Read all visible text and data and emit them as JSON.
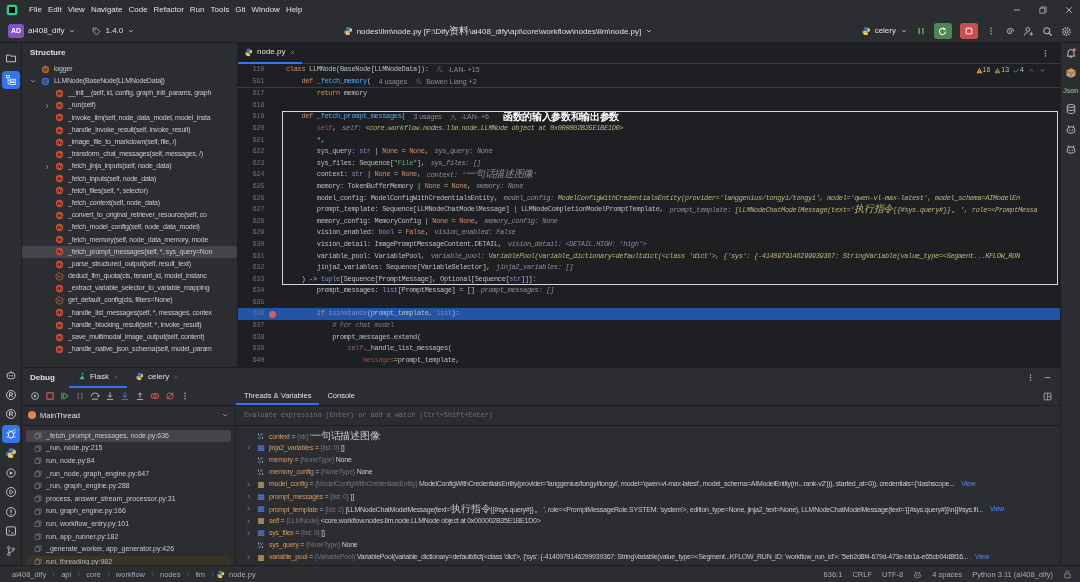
{
  "menu": [
    "File",
    "Edit",
    "View",
    "Navigate",
    "Code",
    "Refactor",
    "Run",
    "Tools",
    "Git",
    "Window",
    "Help"
  ],
  "toolbar": {
    "project_initials": "AD",
    "project": "ai408_dify",
    "version": "1.4.0",
    "file_path": "nodes\\llm\\node.py [F:\\Dify资料\\ai408_dify\\api\\core\\workflow\\nodes\\llm\\node.py]",
    "run_config": "celery"
  },
  "left_tools": [
    {
      "kind": "folder",
      "selected": false
    },
    {
      "kind": "structure",
      "selected": true
    }
  ],
  "lower_tools": [
    {
      "kind": "robot",
      "selected": false
    },
    {
      "kind": "remote",
      "selected": false
    },
    {
      "kind": "remote",
      "selected": false
    },
    {
      "kind": "debug",
      "selected": true
    },
    {
      "kind": "python",
      "selected": false
    },
    {
      "kind": "services",
      "selected": false
    },
    {
      "kind": "run",
      "selected": false
    },
    {
      "kind": "problems",
      "selected": false
    },
    {
      "kind": "terminal",
      "selected": false
    },
    {
      "kind": "git",
      "selected": false
    }
  ],
  "right_tools": [
    {
      "kind": "bell"
    },
    {
      "kind": "plugin"
    },
    {
      "kind": "label",
      "label": "Json"
    },
    {
      "kind": "database"
    },
    {
      "kind": "assistant"
    },
    {
      "kind": "assistant"
    }
  ],
  "structure": {
    "title": "Structure",
    "items": [
      {
        "label": "logger",
        "kind": "variable",
        "selected": false
      },
      {
        "label": "LLMNode(BaseNode[LLMNodeData])",
        "kind": "class",
        "expanded": true,
        "selected": false,
        "children": [
          {
            "label": "__init__(self, id, config, graph_init_params, graph",
            "kind": "method",
            "selected": false
          },
          {
            "label": "_run(self)",
            "kind": "method",
            "expanded": false,
            "selected": false
          },
          {
            "label": "_invoke_llm(self, node_data_model, model_insta",
            "kind": "method",
            "selected": false
          },
          {
            "label": "_handle_invoke_result(self, invoke_result)",
            "kind": "method",
            "selected": false
          },
          {
            "label": "_image_file_to_markdown(self, file, /)",
            "kind": "method",
            "selected": false
          },
          {
            "label": "_transform_chat_messages(self, messages, /)",
            "kind": "method",
            "selected": false
          },
          {
            "label": "_fetch_jinja_inputs(self, node_data)",
            "kind": "method",
            "expanded": false,
            "selected": false
          },
          {
            "label": "_fetch_inputs(self, node_data)",
            "kind": "method",
            "selected": false
          },
          {
            "label": "_fetch_files(self, *, selector)",
            "kind": "method",
            "selected": false
          },
          {
            "label": "_fetch_context(self, node_data)",
            "kind": "method",
            "selected": false
          },
          {
            "label": "_convert_to_original_retriever_resource(self, co",
            "kind": "method",
            "selected": false
          },
          {
            "label": "_fetch_model_config(self, node_data_model)",
            "kind": "method",
            "selected": false
          },
          {
            "label": "_fetch_memory(self, node_data_memory, mode",
            "kind": "method",
            "selected": false
          },
          {
            "label": "_fetch_prompt_messages(self, *, sys_query=Non",
            "kind": "method",
            "selected": true
          },
          {
            "label": "_parse_structured_output(self, result_text)",
            "kind": "method",
            "selected": false
          },
          {
            "label": "deduct_llm_quota(cls, tenant_id, model_instanc",
            "kind": "static",
            "selected": false
          },
          {
            "label": "_extract_variable_selector_to_variable_mapping",
            "kind": "method",
            "selected": false
          },
          {
            "label": "get_default_config(cls, filters=None)",
            "kind": "static",
            "selected": false
          },
          {
            "label": "_handle_list_messages(self, *, messages, contex",
            "kind": "method",
            "selected": false
          },
          {
            "label": "_handle_blocking_result(self, *, invoke_result)",
            "kind": "method",
            "selected": false
          },
          {
            "label": "_save_multimodal_image_output(self, content)",
            "kind": "method",
            "selected": false
          },
          {
            "label": "_handle_native_json_schema(self, model_param",
            "kind": "method",
            "selected": false
          }
        ]
      }
    ]
  },
  "editor": {
    "tab": {
      "label": "node.py",
      "selected": true
    },
    "inspections": [
      {
        "kind": "warning",
        "count": "16"
      },
      {
        "kind": "weak",
        "count": "13"
      },
      {
        "kind": "ok",
        "count": "4"
      }
    ],
    "sticky": [
      {
        "number": "110",
        "parts": [
          {
            "kind": "kw",
            "text": "class "
          },
          {
            "kind": "plain",
            "text": "LLMNode(BaseNode[LLMNodeData]):"
          }
        ],
        "author": "-LAN- +15"
      },
      {
        "number": "591",
        "parts": [
          {
            "kind": "kw",
            "text": "    def "
          },
          {
            "kind": "fn",
            "text": "_fetch_memory"
          },
          {
            "kind": "plain",
            "text": "("
          }
        ],
        "usages": "4 usages",
        "author": "Bowen Liang +2"
      }
    ],
    "lines_before": [
      {
        "number": "617",
        "parts": [
          {
            "kind": "kw",
            "text": "        return "
          },
          {
            "kind": "plain",
            "text": "memory"
          }
        ],
        "breakpoint": false,
        "current": false
      },
      {
        "number": "618",
        "breakpoint": false,
        "current": false
      }
    ],
    "highlight": {
      "note": "函数的输入参数和输出参数",
      "lines": [
        {
          "number": "619",
          "parts": [
            {
              "kind": "kw",
              "text": "    def "
            },
            {
              "kind": "fn",
              "text": "_fetch_prompt_messages"
            },
            {
              "kind": "plain",
              "text": "("
            }
          ],
          "usages": "3 usages",
          "author": "-LAN- +6",
          "breakpoint": false,
          "current": false
        },
        {
          "number": "620",
          "parts": [
            {
              "kind": "self",
              "text": "        self"
            },
            {
              "kind": "plain",
              "text": ","
            }
          ],
          "hint": "self: ",
          "hint_value": "<core.workflow.nodes.llm.node.LLMNode object at 0x000002B35E1BE1D0>",
          "breakpoint": false,
          "current": false
        },
        {
          "number": "621",
          "parts": [
            {
              "kind": "plain",
              "text": "        *,"
            }
          ],
          "breakpoint": false,
          "current": false
        },
        {
          "number": "622",
          "parts": [
            {
              "kind": "plain",
              "text": "        sys_query: "
            },
            {
              "kind": "builtin",
              "text": "str"
            },
            {
              "kind": "plain",
              "text": " | "
            },
            {
              "kind": "kw",
              "text": "None"
            },
            {
              "kind": "plain",
              "text": " = "
            },
            {
              "kind": "kw",
              "text": "None"
            },
            {
              "kind": "plain",
              "text": ","
            }
          ],
          "hint": "sys_query: None",
          "breakpoint": false,
          "current": false
        },
        {
          "number": "623",
          "parts": [
            {
              "kind": "plain",
              "text": "        sys_files: Sequence["
            },
            {
              "kind": "str",
              "text": "\"File\""
            },
            {
              "kind": "plain",
              "text": "],"
            }
          ],
          "hint": "sys_files: []",
          "breakpoint": false,
          "current": false
        },
        {
          "number": "624",
          "parts": [
            {
              "kind": "plain",
              "text": "        context: "
            },
            {
              "kind": "builtin",
              "text": "str"
            },
            {
              "kind": "plain",
              "text": " | "
            },
            {
              "kind": "kw",
              "text": "None"
            },
            {
              "kind": "plain",
              "text": " = "
            },
            {
              "kind": "kw",
              "text": "None"
            },
            {
              "kind": "plain",
              "text": ","
            }
          ],
          "hint": "context: '一句话描述图像'",
          "breakpoint": false,
          "current": false
        },
        {
          "number": "625",
          "parts": [
            {
              "kind": "plain",
              "text": "        memory: TokenBufferMemory | "
            },
            {
              "kind": "kw",
              "text": "None"
            },
            {
              "kind": "plain",
              "text": " = "
            },
            {
              "kind": "kw",
              "text": "None"
            },
            {
              "kind": "plain",
              "text": ","
            }
          ],
          "hint": "memory: None",
          "breakpoint": false,
          "current": false
        },
        {
          "number": "626",
          "parts": [
            {
              "kind": "plain",
              "text": "        model_config: ModelConfigWithCredentialsEntity,"
            }
          ],
          "hint": "model_config: ",
          "hint_value": "ModelConfigWithCredentialsEntity(provider='langgenius/tongyi/tongyi', model='qwen-vl-max-latest', model_schema=AIModelEn",
          "breakpoint": false,
          "current": false
        },
        {
          "number": "627",
          "parts": [
            {
              "kind": "plain",
              "text": "        prompt_template: Sequence[LLMNodeChatModelMessage] | LLMNodeCompletionModelPromptTemplate,"
            }
          ],
          "hint": "prompt_template: ",
          "hint_value": "[LLMNodeChatModelMessage(text='执行指令{{#sys.query#}}。', role=<PromptMessa",
          "breakpoint": false,
          "current": false
        },
        {
          "number": "628",
          "parts": [
            {
              "kind": "plain",
              "text": "        memory_config: MemoryConfig | "
            },
            {
              "kind": "kw",
              "text": "None"
            },
            {
              "kind": "plain",
              "text": " = "
            },
            {
              "kind": "kw",
              "text": "None"
            },
            {
              "kind": "plain",
              "text": ","
            }
          ],
          "hint": "memory_config: None",
          "breakpoint": false,
          "current": false
        },
        {
          "number": "629",
          "parts": [
            {
              "kind": "plain",
              "text": "        vision_enabled: "
            },
            {
              "kind": "builtin",
              "text": "bool"
            },
            {
              "kind": "plain",
              "text": " = "
            },
            {
              "kind": "kw",
              "text": "False"
            },
            {
              "kind": "plain",
              "text": ","
            }
          ],
          "hint": "vision_enabled: False",
          "breakpoint": false,
          "current": false
        },
        {
          "number": "630",
          "parts": [
            {
              "kind": "plain",
              "text": "        vision_detail: ImagePromptMessageContent.DETAIL,"
            }
          ],
          "hint": "vision_detail: <DETAIL.HIGH: 'high'>",
          "breakpoint": false,
          "current": false
        },
        {
          "number": "631",
          "parts": [
            {
              "kind": "plain",
              "text": "        variable_pool: VariablePool,"
            }
          ],
          "hint": "variable_pool: ",
          "hint_value": "VariablePool(variable_dictionary=defaultdict(<class 'dict'>, {'sys': {-4140979146299939367: StringVariable(value_type=<Segment...KFLOW_RUN",
          "breakpoint": false,
          "current": false
        },
        {
          "number": "632",
          "parts": [
            {
              "kind": "plain",
              "text": "        jinja2_variables: Sequence[VariableSelector],"
            }
          ],
          "hint": "jinja2_variables: []",
          "breakpoint": false,
          "current": false
        },
        {
          "number": "633",
          "parts": [
            {
              "kind": "plain",
              "text": "    ) -> "
            },
            {
              "kind": "builtin",
              "text": "tuple"
            },
            {
              "kind": "plain",
              "text": "[Sequence[PromptMessage], Optional[Sequence["
            },
            {
              "kind": "builtin",
              "text": "str"
            },
            {
              "kind": "plain",
              "text": "]]]:"
            }
          ],
          "breakpoint": false,
          "current": false
        }
      ]
    },
    "lines_after": [
      {
        "number": "634",
        "parts": [
          {
            "kind": "plain",
            "text": "        prompt_messages: "
          },
          {
            "kind": "builtin",
            "text": "list"
          },
          {
            "kind": "plain",
            "text": "[PromptMessage] = []"
          }
        ],
        "hint": "prompt_messages: []",
        "breakpoint": false,
        "current": false
      },
      {
        "number": "635",
        "breakpoint": false,
        "current": false
      },
      {
        "number": "636",
        "parts": [
          {
            "kind": "kw",
            "text": "        if "
          },
          {
            "kind": "builtin",
            "text": "isinstance"
          },
          {
            "kind": "plain",
            "text": "(prompt_template, "
          },
          {
            "kind": "builtin",
            "text": "list"
          },
          {
            "kind": "plain",
            "text": "):"
          }
        ],
        "breakpoint": true,
        "current": true
      },
      {
        "number": "637",
        "parts": [
          {
            "kind": "comment",
            "text": "            # For chat model"
          }
        ],
        "breakpoint": false,
        "current": false
      },
      {
        "number": "638",
        "parts": [
          {
            "kind": "plain",
            "text": "            prompt_messages.extend("
          }
        ],
        "breakpoint": false,
        "current": false
      },
      {
        "number": "639",
        "parts": [
          {
            "kind": "self",
            "text": "                self"
          },
          {
            "kind": "plain",
            "text": "._handle_list_messages("
          }
        ],
        "breakpoint": false,
        "current": false
      },
      {
        "number": "640",
        "parts": [
          {
            "kind": "param",
            "text": "                    messages"
          },
          {
            "kind": "plain",
            "text": "=prompt_template,"
          }
        ],
        "breakpoint": false,
        "current": false
      }
    ]
  },
  "debug": {
    "title": "Debug",
    "sessions": [
      {
        "label": "Flask",
        "kind": "flask",
        "selected": true
      },
      {
        "label": "celery",
        "kind": "python",
        "selected": false
      }
    ],
    "views": [
      {
        "label": "Threads & Variables",
        "selected": true
      },
      {
        "label": "Console",
        "selected": false
      }
    ],
    "thread": "MainThread",
    "evaluate_placeholder": "Evaluate expression (Enter) or add a watch (Ctrl+Shift+Enter)",
    "frames": [
      {
        "label": "_fetch_prompt_messages, node.py:636",
        "kind": "user",
        "selected": true
      },
      {
        "label": "_run, node.py:215",
        "kind": "user",
        "selected": false
      },
      {
        "label": "run, node.py:84",
        "kind": "user",
        "selected": false
      },
      {
        "label": "_run_node, graph_engine.py:647",
        "kind": "user",
        "selected": false
      },
      {
        "label": "_run, graph_engine.py:288",
        "kind": "user",
        "selected": false
      },
      {
        "label": "process, answer_stream_processor.py:31",
        "kind": "user",
        "selected": false
      },
      {
        "label": "run, graph_engine.py:166",
        "kind": "user",
        "selected": false
      },
      {
        "label": "run, workflow_entry.py:101",
        "kind": "user",
        "selected": false
      },
      {
        "label": "run, app_runner.py:182",
        "kind": "user",
        "selected": false
      },
      {
        "label": "_generate_worker, app_generator.py:426",
        "kind": "user",
        "selected": false
      },
      {
        "label": "run, threading.py:982",
        "kind": "library",
        "selected": false
      }
    ],
    "variables": [
      {
        "name": "context",
        "operator": "=",
        "type": "{str}",
        "value": "'一句话描述图像'",
        "kind": "scalar"
      },
      {
        "name": "jinja2_variables",
        "operator": "=",
        "type": "{list: 0}",
        "value": "[]",
        "kind": "list",
        "expanded": false
      },
      {
        "name": "memory",
        "operator": "=",
        "type": "{NoneType}",
        "value": "None",
        "kind": "scalar"
      },
      {
        "name": "memory_config",
        "operator": "=",
        "type": "{NoneType}",
        "value": "None",
        "kind": "scalar"
      },
      {
        "name": "model_config",
        "operator": "=",
        "type": "{ModelConfigWithCredentialsEntity}",
        "value": "ModelConfigWithCredentialsEntity(provider='langgenius/tongyi/tongyi', model='qwen-vl-max-latest', model_schema=AIModelEntity(m...rank-v2'))), started_at=0)), credentials={'dashscope...",
        "link": "View",
        "kind": "object",
        "expanded": false
      },
      {
        "name": "prompt_messages",
        "operator": "=",
        "type": "{list: 0}",
        "value": "[]",
        "kind": "list",
        "expanded": false
      },
      {
        "name": "prompt_template",
        "operator": "=",
        "type": "{list: 2}",
        "value": "[LLMNodeChatModelMessage(text='执行指令{{#sys.query#}}。', role=<PromptMessageRole.SYSTEM: 'system'>, edition_type=None, jinja2_text=None), LLMNodeChatModelMessage(text='{{#sys.query#}}\\n{{#sys.fil...",
        "link": "View",
        "kind": "list",
        "expanded": false
      },
      {
        "name": "self",
        "operator": "=",
        "type": "{LLMNode}",
        "value": "<core.workflow.nodes.llm.node.LLMNode object at 0x000002B35E1BE1D0>",
        "kind": "object",
        "expanded": false
      },
      {
        "name": "sys_files",
        "operator": "=",
        "type": "{list: 0}",
        "value": "[]",
        "kind": "list",
        "expanded": false
      },
      {
        "name": "sys_query",
        "operator": "=",
        "type": "{NoneType}",
        "value": "None",
        "kind": "scalar"
      },
      {
        "name": "variable_pool",
        "operator": "=",
        "type": "{VariablePool}",
        "value": "VariablePool(variable_dictionary=defaultdict(<class 'dict'>, {'sys': {-4140979146299939367: StringVariable(value_type=<Segment...KFLOW_RUN_ID: 'workflow_run_id'>: '5eb2d8f4-679d-473e-bb1a-e65cb04d8f16...",
        "link": "View",
        "kind": "object",
        "expanded": false
      }
    ]
  },
  "status_bar": {
    "breadcrumbs": [
      "ai408_dify",
      "api",
      "core",
      "workflow",
      "nodes",
      "llm",
      "node.py"
    ],
    "items": [
      {
        "kind": "text",
        "label": "636:1"
      },
      {
        "kind": "text",
        "label": "CRLF"
      },
      {
        "kind": "text",
        "label": "UTF-8"
      },
      {
        "kind": "assistant"
      },
      {
        "kind": "text",
        "label": "4 spaces"
      },
      {
        "kind": "text",
        "label": "Python 3.11 (ai408_dify)"
      },
      {
        "kind": "lock"
      }
    ]
  }
}
